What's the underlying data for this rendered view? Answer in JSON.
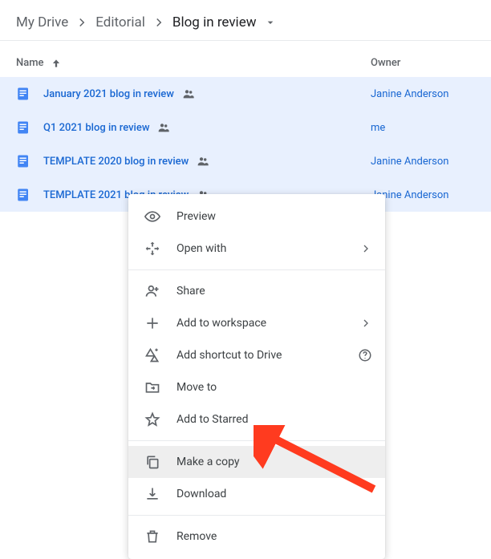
{
  "breadcrumb": {
    "items": [
      "My Drive",
      "Editorial",
      "Blog in review"
    ]
  },
  "headers": {
    "name": "Name",
    "owner": "Owner"
  },
  "files": [
    {
      "name": "January 2021 blog in review",
      "owner": "Janine Anderson",
      "shared": true
    },
    {
      "name": "Q1 2021 blog in review",
      "owner": "me",
      "shared": true
    },
    {
      "name": "TEMPLATE 2020 blog in review",
      "owner": "Janine Anderson",
      "shared": true
    },
    {
      "name": "TEMPLATE 2021 blog in review",
      "owner": "Janine Anderson",
      "shared": true
    }
  ],
  "menu": {
    "preview": "Preview",
    "openwith": "Open with",
    "share": "Share",
    "addworkspace": "Add to workspace",
    "shortcut": "Add shortcut to Drive",
    "moveto": "Move to",
    "starred": "Add to Starred",
    "copy": "Make a copy",
    "download": "Download",
    "remove": "Remove"
  },
  "colors": {
    "accent": "#1967d2",
    "selectedRow": "#e8f0fe",
    "annotation": "#ff3b1f"
  }
}
